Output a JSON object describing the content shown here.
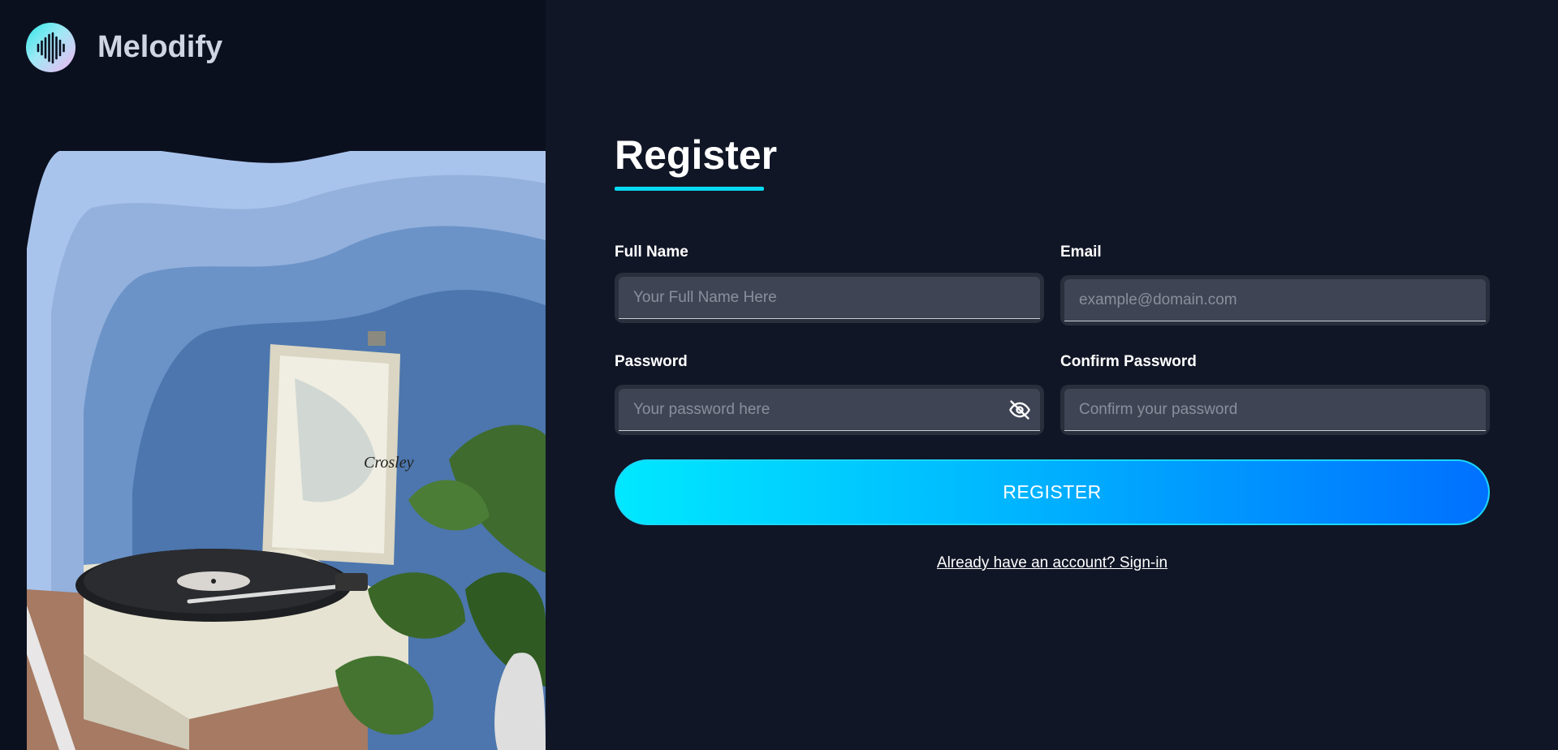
{
  "brand": {
    "name": "Melodify",
    "logo_icon": "soundwave-icon"
  },
  "form": {
    "title": "Register",
    "full_name": {
      "label": "Full Name",
      "placeholder": "Your Full Name Here",
      "value": ""
    },
    "email": {
      "label": "Email",
      "placeholder": "example@domain.com",
      "value": ""
    },
    "password": {
      "label": "Password",
      "placeholder": "Your password here",
      "value": "",
      "toggle_icon": "eye-off-icon"
    },
    "confirm_password": {
      "label": "Confirm Password",
      "placeholder": "Confirm your password",
      "value": ""
    },
    "submit_label": "REGISTER",
    "signin_text": "Already have an account? Sign-in"
  },
  "illustration": {
    "record_player_brand": "Crosley"
  },
  "colors": {
    "background": "#111626",
    "panel_left": "#0b101f",
    "accent": "#08d8f2",
    "button_gradient_start": "#00e8ff",
    "button_gradient_end": "#0070ff",
    "input_bg": "#3f4455"
  }
}
